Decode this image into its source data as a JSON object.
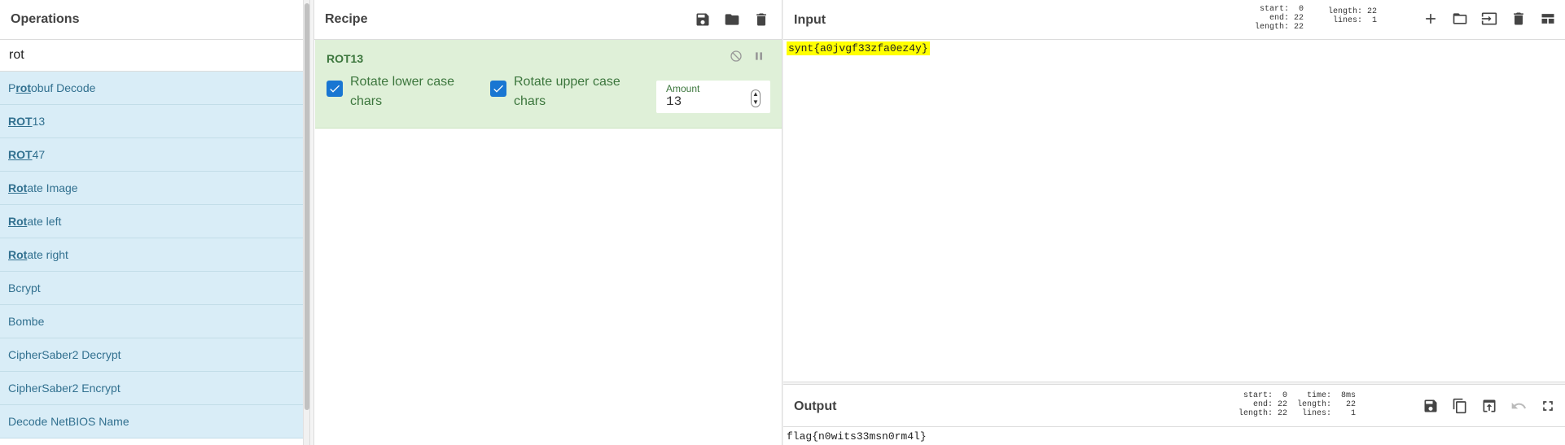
{
  "operations": {
    "title": "Operations",
    "search_value": "rot",
    "items": [
      {
        "pre": "P",
        "match": "rot",
        "post": "obuf Decode"
      },
      {
        "pre": "",
        "match": "ROT",
        "post": "13"
      },
      {
        "pre": "",
        "match": "ROT",
        "post": "47"
      },
      {
        "pre": "",
        "match": "Rot",
        "post": "ate Image"
      },
      {
        "pre": "",
        "match": "Rot",
        "post": "ate left"
      },
      {
        "pre": "",
        "match": "Rot",
        "post": "ate right"
      },
      {
        "pre": "Bcrypt",
        "match": "",
        "post": ""
      },
      {
        "pre": "Bombe",
        "match": "",
        "post": ""
      },
      {
        "pre": "CipherSaber2 Decrypt",
        "match": "",
        "post": ""
      },
      {
        "pre": "CipherSaber2 Encrypt",
        "match": "",
        "post": ""
      },
      {
        "pre": "Decode NetBIOS Name",
        "match": "",
        "post": ""
      }
    ]
  },
  "recipe": {
    "title": "Recipe",
    "icons": [
      "save-icon",
      "folder-icon",
      "trash-icon"
    ],
    "operation": {
      "name": "ROT13",
      "lower_label_1": "Rotate lower case",
      "lower_label_2": "chars",
      "upper_label_1": "Rotate upper case",
      "upper_label_2": "chars",
      "lower_checked": true,
      "upper_checked": true,
      "amount_label": "Amount",
      "amount_value": "13"
    }
  },
  "input": {
    "title": "Input",
    "stats_left": "start:  0\n  end: 22\nlength: 22",
    "stats_right": "length: 22\n lines:  1",
    "text": "synt{a0jvgf33zfa0ez4y}",
    "icons": [
      "plus-icon",
      "folder-icon",
      "import-icon",
      "trash-icon",
      "layout-icon"
    ]
  },
  "output": {
    "title": "Output",
    "stats_left": "start:  0\n  end: 22\nlength: 22",
    "stats_right": "  time:  8ms\nlength:   22\n lines:    1",
    "text": "flag{n0wits33msn0rm4l}",
    "icons": [
      "save-icon",
      "copy-icon",
      "replace-input-icon",
      "undo-icon",
      "maximize-icon"
    ]
  },
  "colors": {
    "op_item_bg": "#d9edf7",
    "op_item_text": "#31708f",
    "recipe_card_bg": "#dff0d8",
    "recipe_card_text": "#3c763d",
    "checkbox": "#1976d2",
    "highlight": "#ffff00"
  }
}
